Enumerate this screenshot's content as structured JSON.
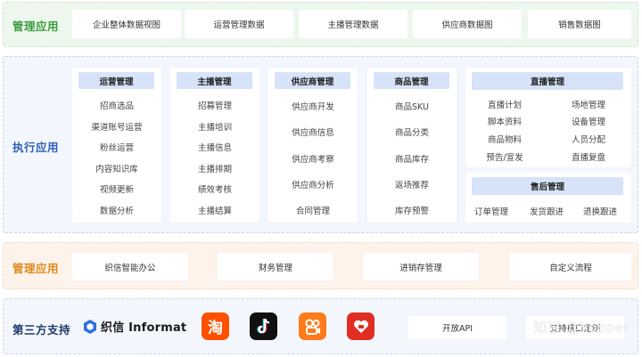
{
  "layers": {
    "top": {
      "title": "管理应用",
      "cards": [
        "企业整体数据视图",
        "运营管理数据",
        "主播管理数据",
        "供应商数据图",
        "销售数据图"
      ]
    },
    "exec": {
      "title": "执行应用",
      "columns": [
        {
          "title": "运营管理",
          "items": [
            "招商选品",
            "渠道账号运营",
            "粉丝运营",
            "内容知识库",
            "视频更新",
            "数据分析"
          ]
        },
        {
          "title": "主播管理",
          "items": [
            "招募管理",
            "主播培训",
            "主播信息",
            "主播排期",
            "绩效考核",
            "主播结算"
          ]
        },
        {
          "title": "供应商管理",
          "items": [
            "供应商开发",
            "供应商信息",
            "供应商考察",
            "供应商分析",
            "合同管理"
          ]
        },
        {
          "title": "商品管理",
          "items": [
            "商品SKU",
            "商品分类",
            "商品库存",
            "返场推荐",
            "库存预警"
          ]
        }
      ],
      "live": {
        "title": "直播管理",
        "items": [
          "直播计划",
          "场地管理",
          "脚本资料",
          "设备管理",
          "商品物料",
          "人员分配",
          "预告/宣发",
          "直播复盘"
        ]
      },
      "aftersale": {
        "title": "售后管理",
        "items": [
          "订单管理",
          "发货跟进",
          "退换跟进"
        ]
      }
    },
    "mgmt": {
      "title": "管理应用",
      "cards": [
        "织信智能办公",
        "财务管理",
        "进销存管理",
        "自定义流程"
      ]
    },
    "third": {
      "title": "第三方支持",
      "brand": "织信 Informat",
      "apps": {
        "taobao": {
          "name": "taobao-icon",
          "glyph": "淘",
          "color": "#ff5000"
        },
        "douyin": {
          "name": "douyin-icon",
          "color": "#111111"
        },
        "kuaishou": {
          "name": "kuaishou-icon",
          "color": "#ff7a1a"
        },
        "pdd": {
          "name": "pinduoduo-icon",
          "color": "#e02e24"
        }
      },
      "cards": [
        "开放API",
        "支持接口定制"
      ]
    }
  },
  "watermark": "知乎 @hopper",
  "colors": {
    "green": "#3d9b3f",
    "blue": "#2f5fb8",
    "orange": "#e08a1e",
    "navy": "#1f3a6b",
    "header_fill": "#d6e3f8"
  }
}
